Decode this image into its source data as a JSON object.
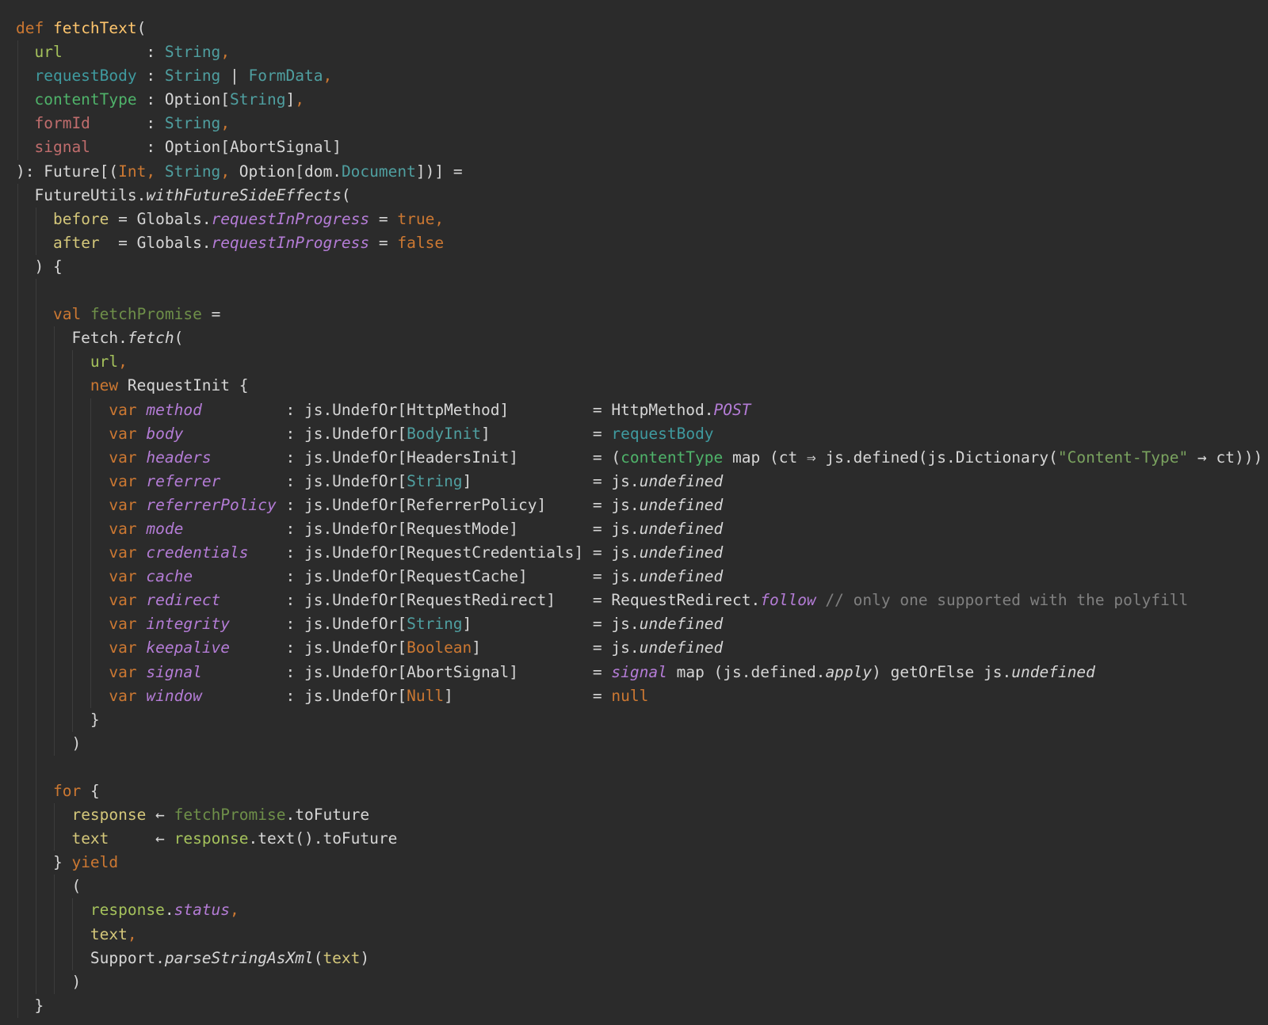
{
  "editor": {
    "language": "scala",
    "lines": [
      [
        {
          "t": "def ",
          "c": "kw"
        },
        {
          "t": "fetchText",
          "c": "fn"
        },
        {
          "t": "(",
          "c": "pl"
        }
      ],
      [
        {
          "t": "  url         ",
          "c": "p1"
        },
        {
          "t": ": ",
          "c": "pl"
        },
        {
          "t": "String",
          "c": "ty"
        },
        {
          "t": ",",
          "c": "kw"
        }
      ],
      [
        {
          "t": "  requestBody ",
          "c": "p2"
        },
        {
          "t": ": ",
          "c": "pl"
        },
        {
          "t": "String ",
          "c": "ty"
        },
        {
          "t": "| ",
          "c": "pl"
        },
        {
          "t": "FormData",
          "c": "ty"
        },
        {
          "t": ",",
          "c": "kw"
        }
      ],
      [
        {
          "t": "  contentType ",
          "c": "p3"
        },
        {
          "t": ": Option[",
          "c": "pl"
        },
        {
          "t": "String",
          "c": "ty"
        },
        {
          "t": "]",
          "c": "pl"
        },
        {
          "t": ",",
          "c": "kw"
        }
      ],
      [
        {
          "t": "  formId      ",
          "c": "p4"
        },
        {
          "t": ": ",
          "c": "pl"
        },
        {
          "t": "String",
          "c": "ty"
        },
        {
          "t": ",",
          "c": "kw"
        }
      ],
      [
        {
          "t": "  signal      ",
          "c": "p4"
        },
        {
          "t": ": Option[AbortSignal]",
          "c": "pl"
        }
      ],
      [
        {
          "t": "): Future[(",
          "c": "pl"
        },
        {
          "t": "Int",
          "c": "kw"
        },
        {
          "t": ", ",
          "c": "kw"
        },
        {
          "t": "String",
          "c": "ty"
        },
        {
          "t": ", ",
          "c": "kw"
        },
        {
          "t": "Option[dom.",
          "c": "pl"
        },
        {
          "t": "Document",
          "c": "ty"
        },
        {
          "t": "])] =",
          "c": "pl"
        }
      ],
      [
        {
          "t": "  FutureUtils.",
          "c": "pl"
        },
        {
          "t": "withFutureSideEffects",
          "c": "mth"
        },
        {
          "t": "(",
          "c": "pl"
        }
      ],
      [
        {
          "t": "    ",
          "c": "pl"
        },
        {
          "t": "before",
          "c": "ylw"
        },
        {
          "t": " = Globals.",
          "c": "pl"
        },
        {
          "t": "requestInProgress",
          "c": "fld"
        },
        {
          "t": " = ",
          "c": "pl"
        },
        {
          "t": "true",
          "c": "kw"
        },
        {
          "t": ",",
          "c": "kw"
        }
      ],
      [
        {
          "t": "    ",
          "c": "pl"
        },
        {
          "t": "after",
          "c": "ylw"
        },
        {
          "t": "  = Globals.",
          "c": "pl"
        },
        {
          "t": "requestInProgress",
          "c": "fld"
        },
        {
          "t": " = ",
          "c": "pl"
        },
        {
          "t": "false",
          "c": "kw"
        }
      ],
      [
        {
          "t": "  ) {",
          "c": "pl"
        }
      ],
      [],
      [
        {
          "t": "    ",
          "c": "pl"
        },
        {
          "t": "val ",
          "c": "kw"
        },
        {
          "t": "fetchPromise",
          "c": "fp"
        },
        {
          "t": " =",
          "c": "pl"
        }
      ],
      [
        {
          "t": "      Fetch.",
          "c": "pl"
        },
        {
          "t": "fetch",
          "c": "mth"
        },
        {
          "t": "(",
          "c": "pl"
        }
      ],
      [
        {
          "t": "        ",
          "c": "pl"
        },
        {
          "t": "url",
          "c": "p1"
        },
        {
          "t": ",",
          "c": "kw"
        }
      ],
      [
        {
          "t": "        ",
          "c": "pl"
        },
        {
          "t": "new ",
          "c": "kw"
        },
        {
          "t": "RequestInit {",
          "c": "pl"
        }
      ],
      [
        {
          "t": "          ",
          "c": "pl"
        },
        {
          "t": "var ",
          "c": "kw"
        },
        {
          "t": "method         ",
          "c": "fld"
        },
        {
          "t": ": js.UndefOr[HttpMethod]         = HttpMethod.",
          "c": "pl"
        },
        {
          "t": "POST",
          "c": "fld"
        }
      ],
      [
        {
          "t": "          ",
          "c": "pl"
        },
        {
          "t": "var ",
          "c": "kw"
        },
        {
          "t": "body           ",
          "c": "fld"
        },
        {
          "t": ": js.UndefOr[",
          "c": "pl"
        },
        {
          "t": "BodyInit",
          "c": "ty"
        },
        {
          "t": "]           = ",
          "c": "pl"
        },
        {
          "t": "requestBody",
          "c": "p2"
        }
      ],
      [
        {
          "t": "          ",
          "c": "pl"
        },
        {
          "t": "var ",
          "c": "kw"
        },
        {
          "t": "headers        ",
          "c": "fld"
        },
        {
          "t": ": js.UndefOr[HeadersInit]        = (",
          "c": "pl"
        },
        {
          "t": "contentType",
          "c": "p3"
        },
        {
          "t": " map (ct ⇒ js.defined(js.Dictionary(",
          "c": "pl"
        },
        {
          "t": "\"Content-Type\"",
          "c": "str"
        },
        {
          "t": " → ct))) ",
          "c": "pl"
        }
      ],
      [
        {
          "t": "          ",
          "c": "pl"
        },
        {
          "t": "var ",
          "c": "kw"
        },
        {
          "t": "referrer       ",
          "c": "fld"
        },
        {
          "t": ": js.UndefOr[",
          "c": "pl"
        },
        {
          "t": "String",
          "c": "ty"
        },
        {
          "t": "]             = js.",
          "c": "pl"
        },
        {
          "t": "undefined",
          "c": "mth"
        }
      ],
      [
        {
          "t": "          ",
          "c": "pl"
        },
        {
          "t": "var ",
          "c": "kw"
        },
        {
          "t": "referrerPolicy ",
          "c": "fld"
        },
        {
          "t": ": js.UndefOr[ReferrerPolicy]     = js.",
          "c": "pl"
        },
        {
          "t": "undefined",
          "c": "mth"
        }
      ],
      [
        {
          "t": "          ",
          "c": "pl"
        },
        {
          "t": "var ",
          "c": "kw"
        },
        {
          "t": "mode           ",
          "c": "fld"
        },
        {
          "t": ": js.UndefOr[RequestMode]        = js.",
          "c": "pl"
        },
        {
          "t": "undefined",
          "c": "mth"
        }
      ],
      [
        {
          "t": "          ",
          "c": "pl"
        },
        {
          "t": "var ",
          "c": "kw"
        },
        {
          "t": "credentials    ",
          "c": "fld"
        },
        {
          "t": ": js.UndefOr[RequestCredentials] = js.",
          "c": "pl"
        },
        {
          "t": "undefined",
          "c": "mth"
        }
      ],
      [
        {
          "t": "          ",
          "c": "pl"
        },
        {
          "t": "var ",
          "c": "kw"
        },
        {
          "t": "cache          ",
          "c": "fld"
        },
        {
          "t": ": js.UndefOr[RequestCache]       = js.",
          "c": "pl"
        },
        {
          "t": "undefined",
          "c": "mth"
        }
      ],
      [
        {
          "t": "          ",
          "c": "pl"
        },
        {
          "t": "var ",
          "c": "kw"
        },
        {
          "t": "redirect       ",
          "c": "fld"
        },
        {
          "t": ": js.UndefOr[RequestRedirect]    = RequestRedirect.",
          "c": "pl"
        },
        {
          "t": "follow",
          "c": "fld"
        },
        {
          "t": " // only one supported with the polyfill",
          "c": "cmt"
        }
      ],
      [
        {
          "t": "          ",
          "c": "pl"
        },
        {
          "t": "var ",
          "c": "kw"
        },
        {
          "t": "integrity      ",
          "c": "fld"
        },
        {
          "t": ": js.UndefOr[",
          "c": "pl"
        },
        {
          "t": "String",
          "c": "ty"
        },
        {
          "t": "]             = js.",
          "c": "pl"
        },
        {
          "t": "undefined",
          "c": "mth"
        }
      ],
      [
        {
          "t": "          ",
          "c": "pl"
        },
        {
          "t": "var ",
          "c": "kw"
        },
        {
          "t": "keepalive      ",
          "c": "fld"
        },
        {
          "t": ": js.UndefOr[",
          "c": "pl"
        },
        {
          "t": "Boolean",
          "c": "kw"
        },
        {
          "t": "]            = js.",
          "c": "pl"
        },
        {
          "t": "undefined",
          "c": "mth"
        }
      ],
      [
        {
          "t": "          ",
          "c": "pl"
        },
        {
          "t": "var ",
          "c": "kw"
        },
        {
          "t": "signal         ",
          "c": "fld"
        },
        {
          "t": ": js.UndefOr[AbortSignal]        = ",
          "c": "pl"
        },
        {
          "t": "signal",
          "c": "fld"
        },
        {
          "t": " map (js.defined.",
          "c": "pl"
        },
        {
          "t": "apply",
          "c": "mth"
        },
        {
          "t": ") getOrElse js.",
          "c": "pl"
        },
        {
          "t": "undefined",
          "c": "mth"
        }
      ],
      [
        {
          "t": "          ",
          "c": "pl"
        },
        {
          "t": "var ",
          "c": "kw"
        },
        {
          "t": "window         ",
          "c": "fld"
        },
        {
          "t": ": js.UndefOr[",
          "c": "pl"
        },
        {
          "t": "Null",
          "c": "kw"
        },
        {
          "t": "]               = ",
          "c": "pl"
        },
        {
          "t": "null",
          "c": "kw"
        }
      ],
      [
        {
          "t": "        }",
          "c": "pl"
        }
      ],
      [
        {
          "t": "      )",
          "c": "pl"
        }
      ],
      [],
      [
        {
          "t": "    ",
          "c": "pl"
        },
        {
          "t": "for ",
          "c": "kw"
        },
        {
          "t": "{",
          "c": "pl"
        }
      ],
      [
        {
          "t": "      ",
          "c": "pl"
        },
        {
          "t": "response",
          "c": "ylw"
        },
        {
          "t": " ← ",
          "c": "pl"
        },
        {
          "t": "fetchPromise",
          "c": "fp"
        },
        {
          "t": ".toFuture",
          "c": "pl"
        }
      ],
      [
        {
          "t": "      ",
          "c": "pl"
        },
        {
          "t": "text",
          "c": "ylw"
        },
        {
          "t": "     ← ",
          "c": "pl"
        },
        {
          "t": "response",
          "c": "grn"
        },
        {
          "t": ".text().toFuture",
          "c": "pl"
        }
      ],
      [
        {
          "t": "    } ",
          "c": "pl"
        },
        {
          "t": "yield",
          "c": "kw"
        }
      ],
      [
        {
          "t": "      (",
          "c": "pl"
        }
      ],
      [
        {
          "t": "        ",
          "c": "pl"
        },
        {
          "t": "response",
          "c": "grn"
        },
        {
          "t": ".",
          "c": "pl"
        },
        {
          "t": "status",
          "c": "fld"
        },
        {
          "t": ",",
          "c": "kw"
        }
      ],
      [
        {
          "t": "        ",
          "c": "pl"
        },
        {
          "t": "text",
          "c": "ylw"
        },
        {
          "t": ",",
          "c": "kw"
        }
      ],
      [
        {
          "t": "        Support.",
          "c": "pl"
        },
        {
          "t": "parseStringAsXml",
          "c": "mth"
        },
        {
          "t": "(",
          "c": "pl"
        },
        {
          "t": "text",
          "c": "ylw"
        },
        {
          "t": ")",
          "c": "pl"
        }
      ],
      [
        {
          "t": "      )",
          "c": "pl"
        }
      ],
      [
        {
          "t": "  }",
          "c": "pl"
        }
      ]
    ]
  }
}
